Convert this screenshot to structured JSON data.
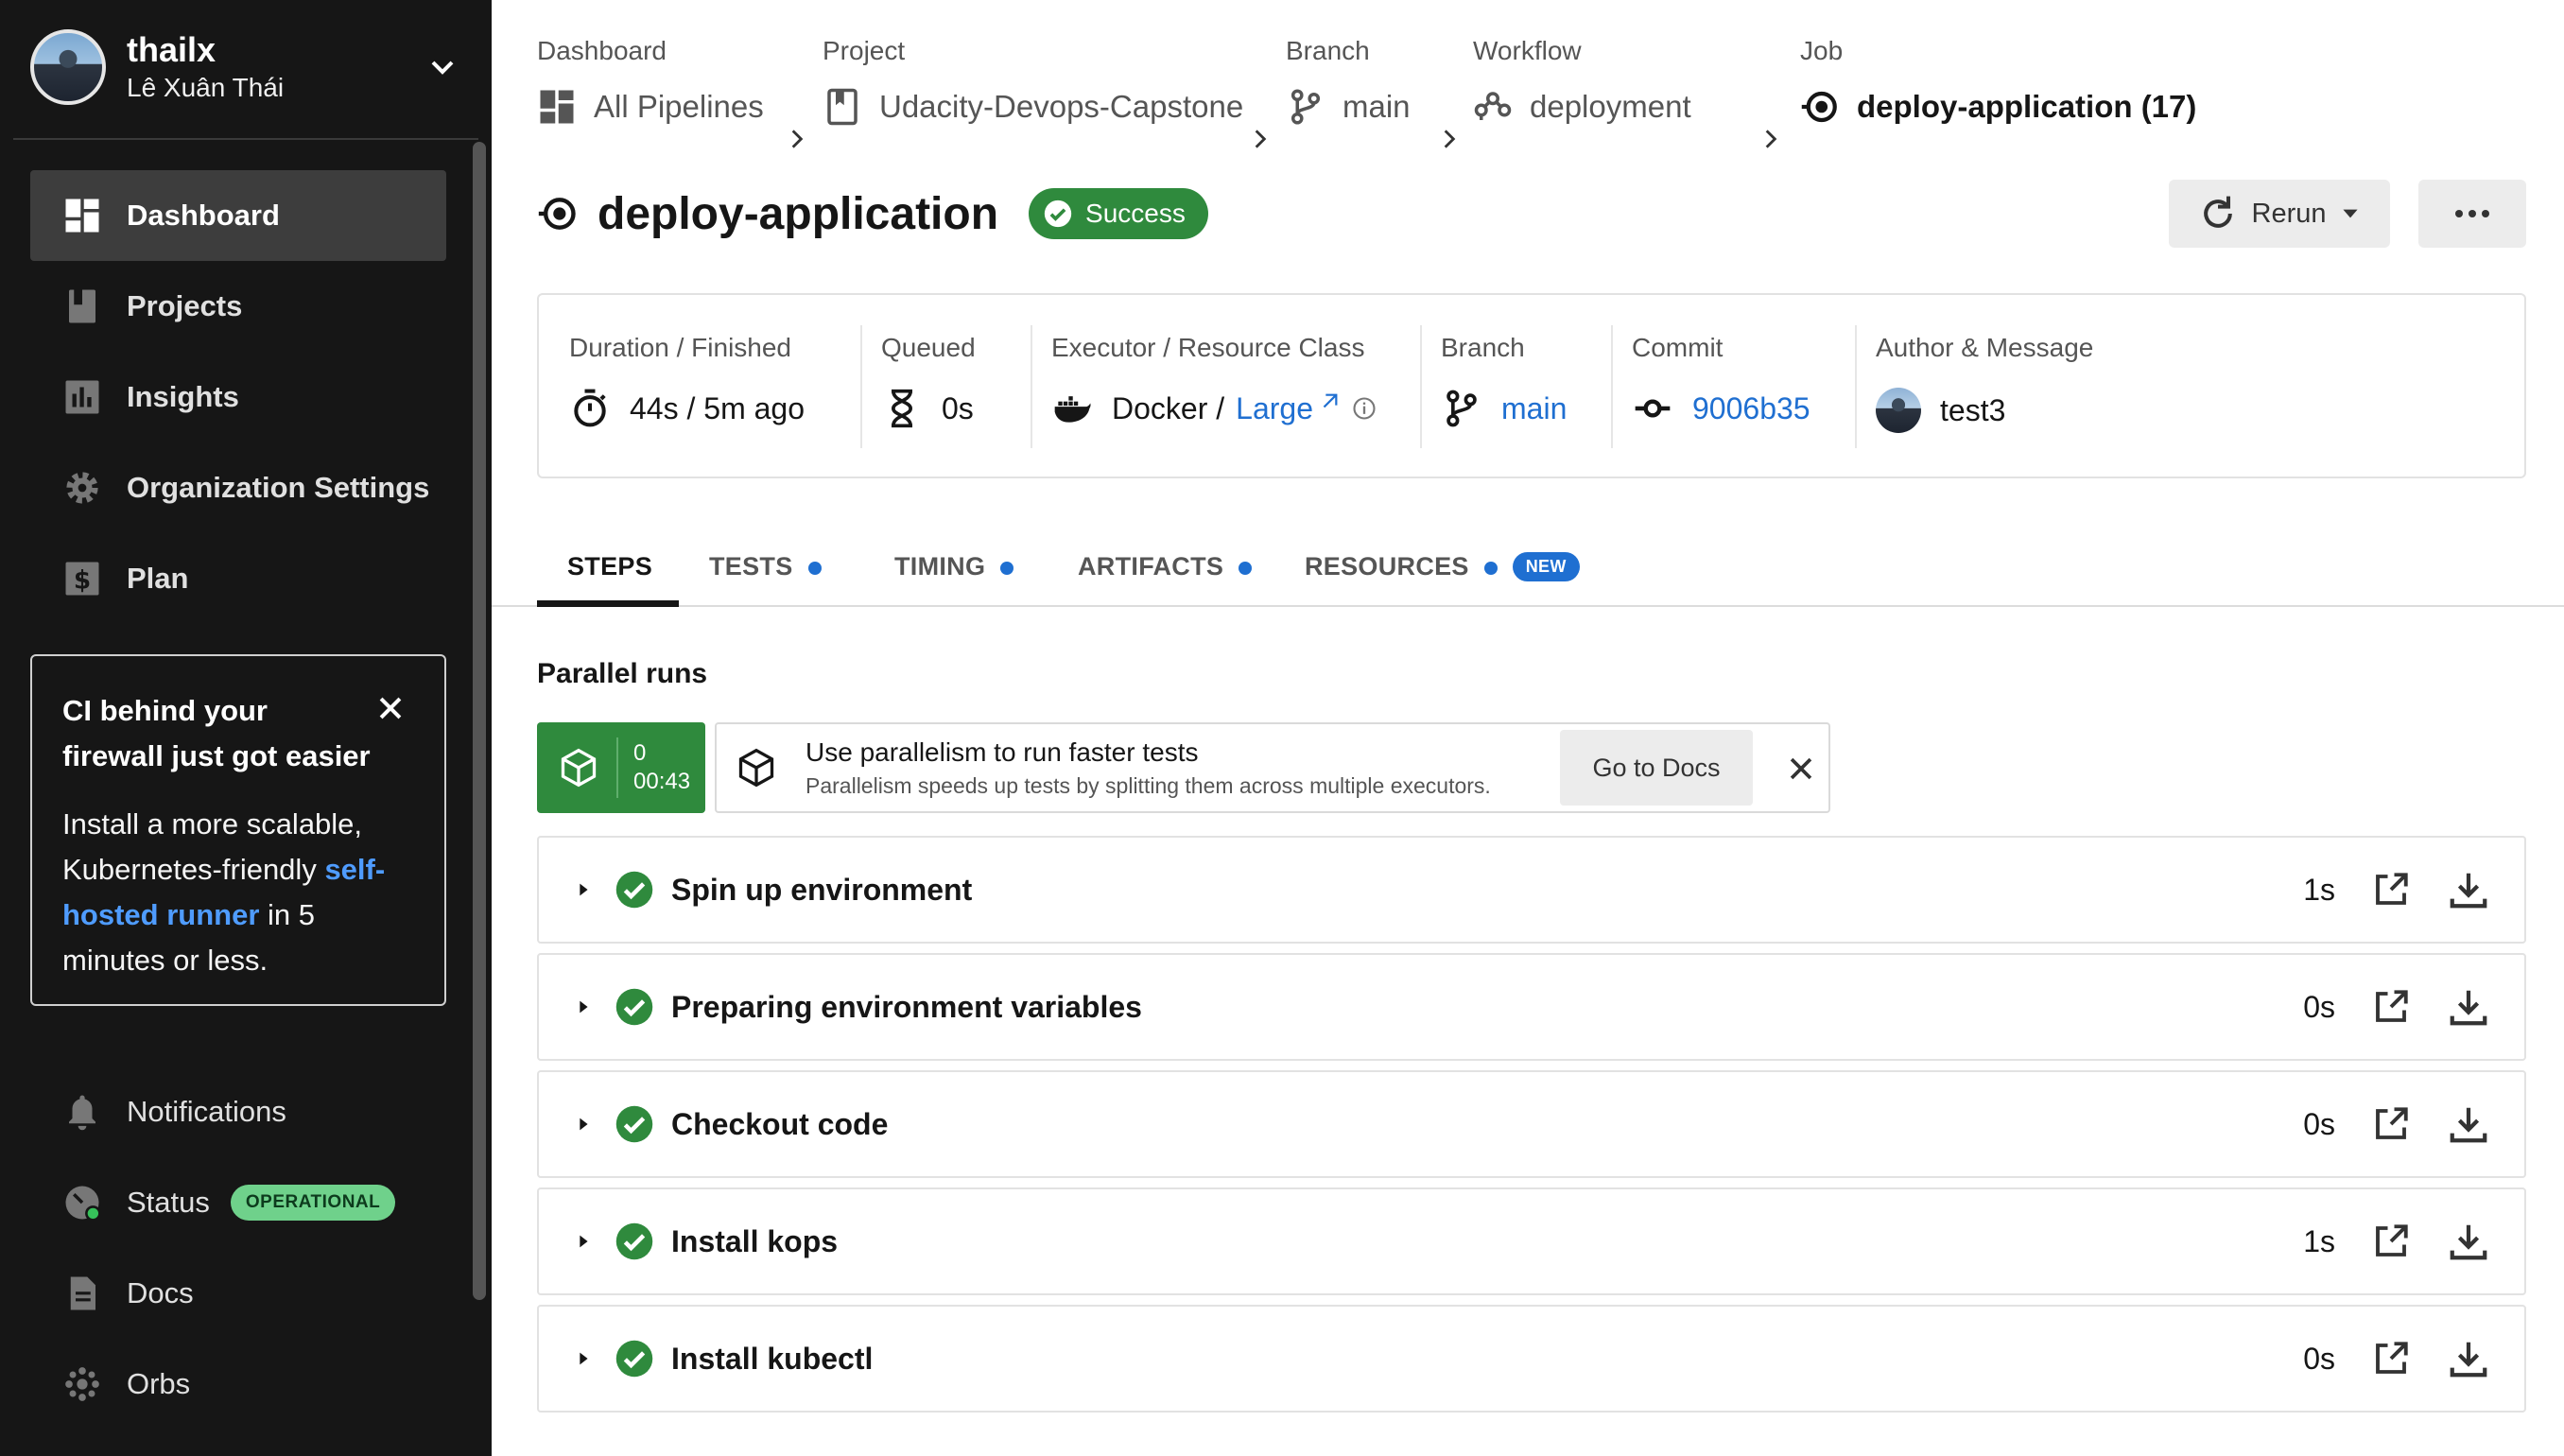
{
  "colors": {
    "sidebar_bg": "#161616",
    "success": "#2f8a3d",
    "link": "#1f6fd1",
    "operational": "#6fd18b"
  },
  "user": {
    "username": "thailx",
    "full_name": "Lê Xuân Thái"
  },
  "sidebar": {
    "items": [
      {
        "label": "Dashboard",
        "icon": "dashboard-icon",
        "active": true
      },
      {
        "label": "Projects",
        "icon": "projects-icon"
      },
      {
        "label": "Insights",
        "icon": "insights-icon"
      },
      {
        "label": "Organization Settings",
        "icon": "gear-icon"
      },
      {
        "label": "Plan",
        "icon": "dollar-icon"
      }
    ],
    "promo": {
      "title": "CI behind your firewall just got easier",
      "body_before": "Install a more scalable, Kubernetes-friendly ",
      "link": "self-hosted runner",
      "body_after": " in 5 minutes or less."
    },
    "bottom_items": [
      {
        "label": "Notifications",
        "icon": "bell-icon"
      },
      {
        "label": "Status",
        "icon": "status-icon",
        "badge": "OPERATIONAL"
      },
      {
        "label": "Docs",
        "icon": "docs-icon"
      },
      {
        "label": "Orbs",
        "icon": "orbs-icon"
      }
    ]
  },
  "breadcrumbs": [
    {
      "label": "Dashboard",
      "value": "All Pipelines",
      "icon": "pipelines-icon"
    },
    {
      "label": "Project",
      "value": "Udacity-Devops-Capstone",
      "icon": "project-icon"
    },
    {
      "label": "Branch",
      "value": "main",
      "icon": "branch-icon"
    },
    {
      "label": "Workflow",
      "value": "deployment",
      "icon": "workflow-icon"
    },
    {
      "label": "Job",
      "value": "deploy-application (17)",
      "icon": "job-icon"
    }
  ],
  "job": {
    "title": "deploy-application",
    "status": "Success",
    "rerun_label": "Rerun"
  },
  "info": {
    "duration": {
      "label": "Duration / Finished",
      "value": "44s / 5m ago"
    },
    "queued": {
      "label": "Queued",
      "value": "0s"
    },
    "executor": {
      "label": "Executor / Resource Class",
      "value": "Docker / ",
      "resource": "Large"
    },
    "branch": {
      "label": "Branch",
      "value": "main"
    },
    "commit": {
      "label": "Commit",
      "value": "9006b35"
    },
    "author": {
      "label": "Author & Message",
      "value": "test3"
    }
  },
  "tabs": [
    {
      "label": "STEPS",
      "active": true
    },
    {
      "label": "TESTS",
      "dot": true
    },
    {
      "label": "TIMING",
      "dot": true
    },
    {
      "label": "ARTIFACTS",
      "dot": true
    },
    {
      "label": "RESOURCES",
      "dot": true,
      "badge": "NEW"
    }
  ],
  "parallel": {
    "title": "Parallel runs",
    "run_index": "0",
    "run_time": "00:43",
    "tip_title": "Use parallelism to run faster tests",
    "tip_body": "Parallelism speeds up tests by splitting them across multiple executors.",
    "docs_button": "Go to Docs"
  },
  "steps": [
    {
      "name": "Spin up environment",
      "duration": "1s"
    },
    {
      "name": "Preparing environment variables",
      "duration": "0s"
    },
    {
      "name": "Checkout code",
      "duration": "0s"
    },
    {
      "name": "Install kops",
      "duration": "1s"
    },
    {
      "name": "Install kubectl",
      "duration": "0s"
    }
  ]
}
